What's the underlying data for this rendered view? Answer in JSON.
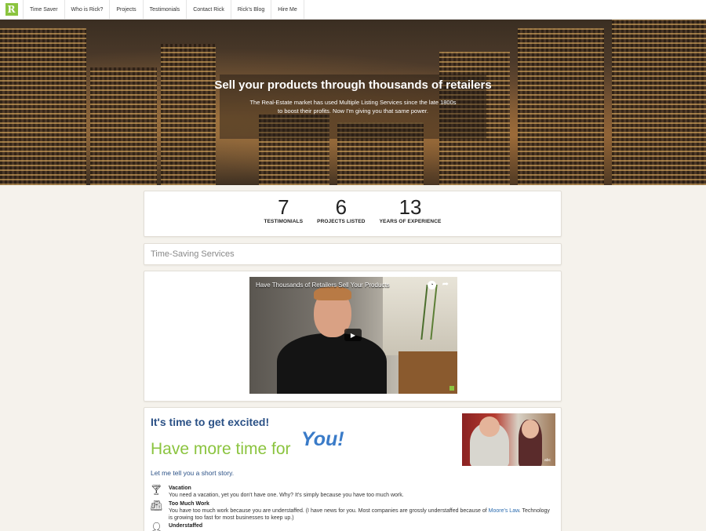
{
  "nav": {
    "logo": "R",
    "items": [
      "Time Saver",
      "Who is Rick?",
      "Projects",
      "Testimonials",
      "Contact Rick",
      "Rick's Blog",
      "Hire Me"
    ]
  },
  "hero": {
    "title": "Sell your products through thousands of retailers",
    "subtitle": "The Real-Estate market has used Multiple Listing Services since the late 1800s to boost their profits. Now I'm giving you that same power."
  },
  "stats": [
    {
      "number": "7",
      "label": "TESTIMONIALS"
    },
    {
      "number": "6",
      "label": "PROJECTS LISTED"
    },
    {
      "number": "13",
      "label": "YEARS OF EXPERIENCE"
    }
  ],
  "services": {
    "heading": "Time-Saving Services"
  },
  "video": {
    "title": "Have Thousands of Retailers Sell Your Products",
    "play_icon": "play-icon",
    "clock_icon": "clock-icon",
    "share_icon": "share-icon"
  },
  "excited": {
    "title": "It's time to get excited!",
    "more_time": "Have more time for",
    "you": "You!",
    "story": "Let me tell you a short story.",
    "photo_tag": "abc",
    "features": [
      {
        "icon": "cocktail-icon",
        "heading": "Vacation",
        "text": "You need a vacation, yet you don't have one. Why? It's simply because you have too much work."
      },
      {
        "icon": "fax-icon",
        "heading": "Too Much Work",
        "text_before": "You have too much work because you are understaffed. (I have news for you. Most companies are grossly understaffed because of ",
        "link": "Moore's Law",
        "text_after": ". Technology is growing too fast for most businesses to keep up.)"
      },
      {
        "icon": "person-icon",
        "heading": "Understaffed",
        "text": ""
      }
    ]
  },
  "colors": {
    "accent_green": "#8bc43f",
    "accent_blue": "#2b5186",
    "link_blue": "#2b6cb0"
  }
}
